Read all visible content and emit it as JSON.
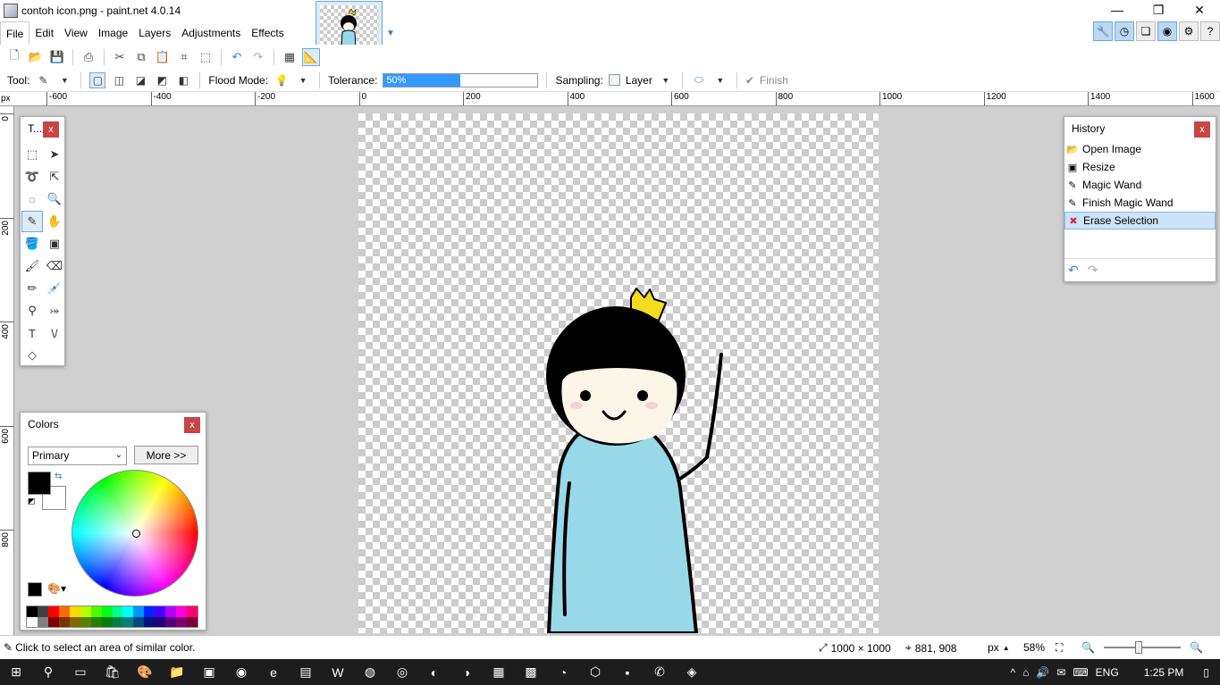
{
  "window": {
    "title": "contoh icon.png - paint.net 4.0.14",
    "minimize_glyph": "—",
    "maximize_glyph": "❐",
    "close_glyph": "✕"
  },
  "menu": [
    "File",
    "Edit",
    "View",
    "Image",
    "Layers",
    "Adjustments",
    "Effects"
  ],
  "toolbar_icons": [
    "new-icon",
    "open-icon",
    "save-icon",
    "print-icon",
    "cut-icon",
    "copy-icon",
    "paste-icon",
    "crop-icon",
    "deselect-icon",
    "undo-icon",
    "redo-icon",
    "grid-icon",
    "rulers-icon"
  ],
  "options": {
    "tool_label": "Tool:",
    "flood_label": "Flood Mode:",
    "tolerance_label": "Tolerance:",
    "tolerance_value": "50%",
    "tolerance_fraction": 0.5,
    "sampling_label": "Sampling:",
    "sampling_value": "Layer",
    "finish_label": "Finish",
    "finish_glyph": "✔"
  },
  "ruler": {
    "unit": "px",
    "h_labels": [
      "-600",
      "-400",
      "-200",
      "0",
      "200",
      "400",
      "600",
      "800",
      "1000",
      "1200",
      "1400",
      "1600"
    ],
    "v_labels": [
      "0",
      "200",
      "400",
      "600",
      "800"
    ]
  },
  "tools_panel": {
    "title": "T...",
    "close": "x"
  },
  "colors_panel": {
    "title": "Colors",
    "close": "x",
    "mode": "Primary",
    "more_label": "More >>",
    "primary_color": "#000000",
    "secondary_color": "#ffffff",
    "palette": [
      "#000000",
      "#404040",
      "#ff0000",
      "#ff6a00",
      "#ffd800",
      "#b6ff00",
      "#4cff00",
      "#00ff21",
      "#00ff90",
      "#00ffff",
      "#0094ff",
      "#0026ff",
      "#4800ff",
      "#b200ff",
      "#ff00dc",
      "#ff006e",
      "#ffffff",
      "#808080",
      "#7f0000",
      "#7f3300",
      "#7f6a00",
      "#5b7f00",
      "#267f00",
      "#007f0e",
      "#007f46",
      "#007f7f",
      "#004a7f",
      "#00137f",
      "#21007f",
      "#57007f",
      "#7f006e",
      "#7f0037"
    ]
  },
  "history_panel": {
    "title": "History",
    "close": "x",
    "items": [
      {
        "label": "Open Image",
        "icon": "open-image-icon",
        "glyph": "📂",
        "selected": false
      },
      {
        "label": "Resize",
        "icon": "resize-icon",
        "glyph": "▣",
        "selected": false
      },
      {
        "label": "Magic Wand",
        "icon": "magic-wand-icon",
        "glyph": "✎",
        "selected": false
      },
      {
        "label": "Finish Magic Wand",
        "icon": "magic-wand-icon",
        "glyph": "✎",
        "selected": false
      },
      {
        "label": "Erase Selection",
        "icon": "erase-icon",
        "glyph": "✖",
        "selected": true
      }
    ]
  },
  "status": {
    "hint": "Click to select an area of similar color.",
    "image_size": "1000 × 1000",
    "cursor_pos": "881, 908",
    "unit": "px",
    "zoom": "58%"
  },
  "taskbar": {
    "language": "ENG",
    "time": "1:25 PM"
  },
  "colors": {
    "accent": "#3399ff",
    "character_shirt": "#99d8e8",
    "character_face": "#fbf6e8",
    "crown": "#f5dd1e"
  }
}
